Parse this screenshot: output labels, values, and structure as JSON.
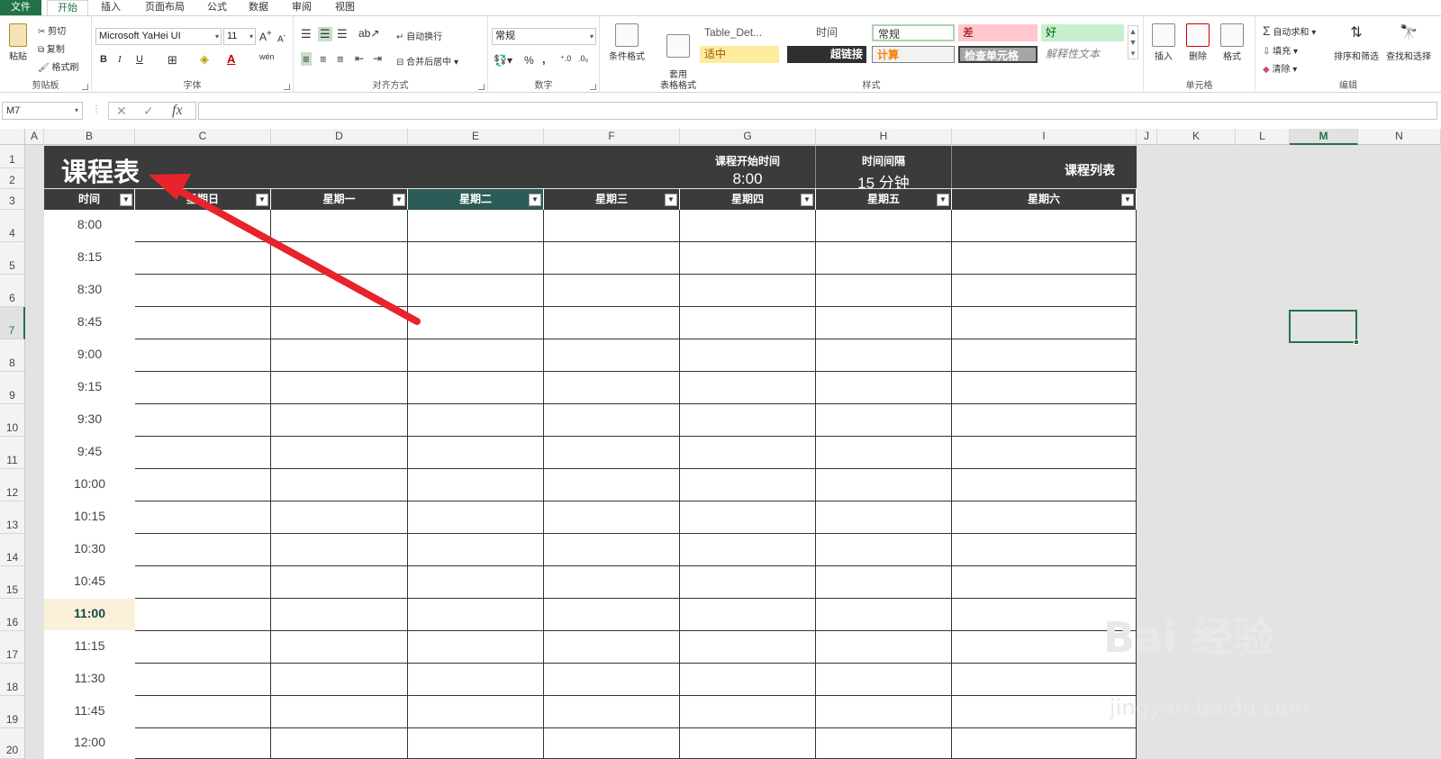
{
  "menu": {
    "file": "文件",
    "home": "开始",
    "insert": "插入",
    "layout": "页面布局",
    "formula": "公式",
    "data": "数据",
    "review": "审阅",
    "view": "视图"
  },
  "ribbon": {
    "clipboard": {
      "paste": "粘贴",
      "cut": "剪切",
      "copy": "复制",
      "painter": "格式刷",
      "label": "剪贴板"
    },
    "font": {
      "name": "Microsoft YaHei UI",
      "size": "11",
      "label": "字体",
      "bold": "B",
      "italic": "I",
      "underline": "U",
      "pinyin": "wén"
    },
    "alignment": {
      "wrap": "自动换行",
      "merge": "合并后居中",
      "label": "对齐方式"
    },
    "number": {
      "format": "常规",
      "percent": "%",
      "comma": ",",
      "label": "数字"
    },
    "styles": {
      "cond": "条件格式",
      "table": "套用\n表格格式",
      "cells": [
        "Table_Det...",
        "时间",
        "常规",
        "差",
        "好",
        "适中",
        "超链接",
        "计算",
        "检查单元格",
        "解释性文本"
      ],
      "label": "样式"
    },
    "cells": {
      "insert": "插入",
      "delete": "删除",
      "format": "格式",
      "label": "单元格"
    },
    "editing": {
      "autosum": "自动求和",
      "fill": "填充",
      "clear": "清除",
      "sort": "排序和筛选",
      "find": "查找和选择",
      "label": "编辑"
    }
  },
  "formula_bar": {
    "namebox": "M7",
    "fx": "fx",
    "value": ""
  },
  "columns": [
    "A",
    "B",
    "C",
    "D",
    "E",
    "F",
    "G",
    "H",
    "I",
    "J",
    "K",
    "L",
    "M",
    "N"
  ],
  "rows": [
    "1",
    "2",
    "3",
    "4",
    "5",
    "6",
    "7",
    "8",
    "9",
    "10",
    "11",
    "12",
    "13",
    "14",
    "15",
    "16",
    "17",
    "18",
    "19",
    "20"
  ],
  "sheet": {
    "title": "课程表",
    "start_label": "课程开始时间",
    "start_value": "8:00",
    "interval_label": "时间间隔",
    "interval_value": "15 分钟",
    "list_label": "课程列表",
    "headers": [
      "时间",
      "星期日",
      "星期一",
      "星期二",
      "星期三",
      "星期四",
      "星期五",
      "星期六"
    ],
    "times": [
      "8:00",
      "8:15",
      "8:30",
      "8:45",
      "9:00",
      "9:15",
      "9:30",
      "9:45",
      "10:00",
      "10:15",
      "10:30",
      "10:45",
      "11:00",
      "11:15",
      "11:30",
      "11:45",
      "12:00"
    ]
  },
  "watermark": {
    "brand": "Bai 经验",
    "url": "jingyan.baidu.com"
  }
}
